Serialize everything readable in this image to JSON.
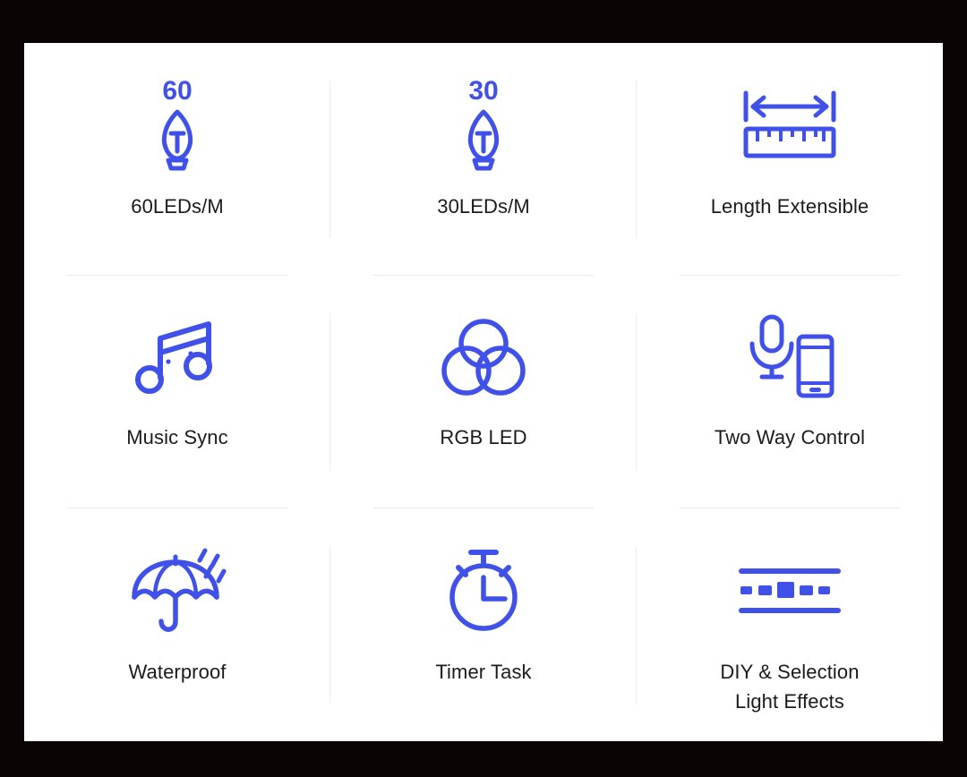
{
  "page": {
    "background_color": "#0a0404",
    "card_background": "#ffffff",
    "accent_color": "#3f51e8",
    "text_color": "#1b1b1b",
    "divider_color": "#e9e9e9"
  },
  "features": [
    {
      "id": "leds-60",
      "label": "60LEDs/M",
      "icon": "led-bulb-60-icon",
      "badge": "60"
    },
    {
      "id": "leds-30",
      "label": "30LEDs/M",
      "icon": "led-bulb-30-icon",
      "badge": "30"
    },
    {
      "id": "length-extensible",
      "label": "Length Extensible",
      "icon": "ruler-measure-icon",
      "badge": ""
    },
    {
      "id": "music-sync",
      "label": "Music Sync",
      "icon": "music-note-icon",
      "badge": ""
    },
    {
      "id": "rgb-led",
      "label": "RGB LED",
      "icon": "rgb-venn-circles-icon",
      "badge": ""
    },
    {
      "id": "two-way-control",
      "label": "Two Way Control",
      "icon": "microphone-phone-icon",
      "badge": ""
    },
    {
      "id": "waterproof",
      "label": "Waterproof",
      "icon": "umbrella-rain-icon",
      "badge": ""
    },
    {
      "id": "timer-task",
      "label": "Timer Task",
      "icon": "stopwatch-icon",
      "badge": ""
    },
    {
      "id": "diy-selection-light-effects",
      "label": "DIY & Selection\nLight Effects",
      "icon": "led-strip-icon",
      "badge": ""
    }
  ]
}
